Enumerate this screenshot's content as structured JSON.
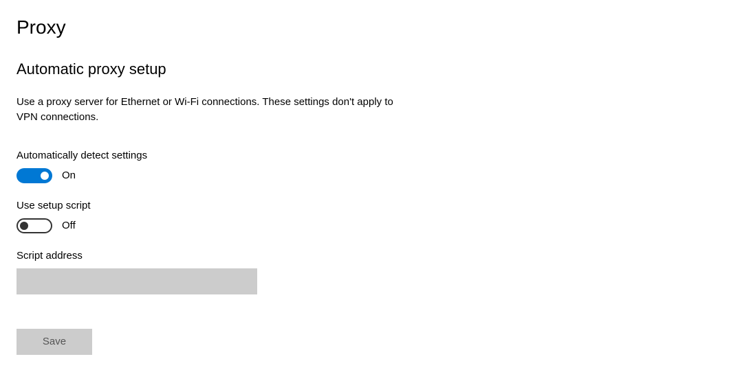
{
  "pageTitle": "Proxy",
  "section": {
    "title": "Automatic proxy setup",
    "description": "Use a proxy server for Ethernet or Wi-Fi connections. These settings don't apply to VPN connections."
  },
  "settings": {
    "autoDetect": {
      "label": "Automatically detect settings",
      "state": "On",
      "enabled": true
    },
    "setupScript": {
      "label": "Use setup script",
      "state": "Off",
      "enabled": false
    },
    "scriptAddress": {
      "label": "Script address",
      "value": ""
    }
  },
  "buttons": {
    "save": "Save"
  }
}
